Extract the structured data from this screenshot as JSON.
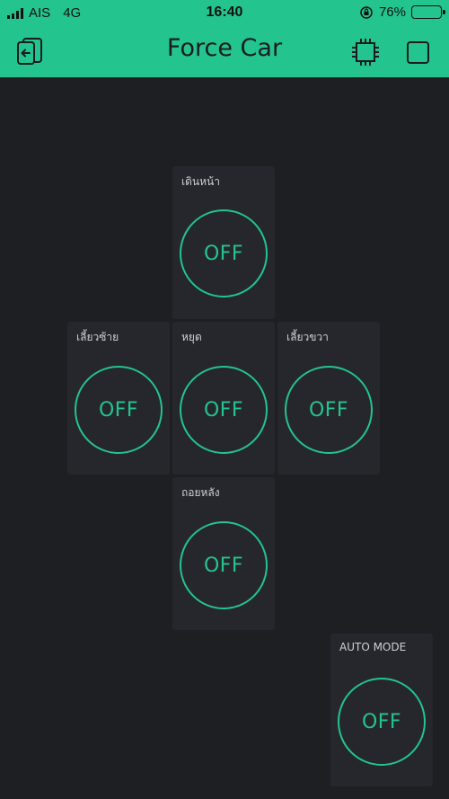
{
  "status_bar": {
    "carrier": "AIS",
    "network": "4G",
    "time": "16:40",
    "battery_percent": "76%",
    "battery_level": 0.76
  },
  "header": {
    "title": "Force Car",
    "left_icon": "exit-device-icon",
    "right_icons": [
      "chip-icon",
      "stop-square-icon"
    ],
    "background_color": "#23c48e"
  },
  "colors": {
    "accent": "#23c48e",
    "background": "#1e1f23",
    "widget": "#26272c"
  },
  "widgets": {
    "forward": {
      "label": "เดินหน้า",
      "state": "OFF"
    },
    "left": {
      "label": "เลี้ยวซ้าย",
      "state": "OFF"
    },
    "stop": {
      "label": "หยุด",
      "state": "OFF"
    },
    "right": {
      "label": "เลี้ยวขวา",
      "state": "OFF"
    },
    "backward": {
      "label": "ถอยหลัง",
      "state": "OFF"
    },
    "auto_mode": {
      "label": "AUTO MODE",
      "state": "OFF"
    }
  }
}
